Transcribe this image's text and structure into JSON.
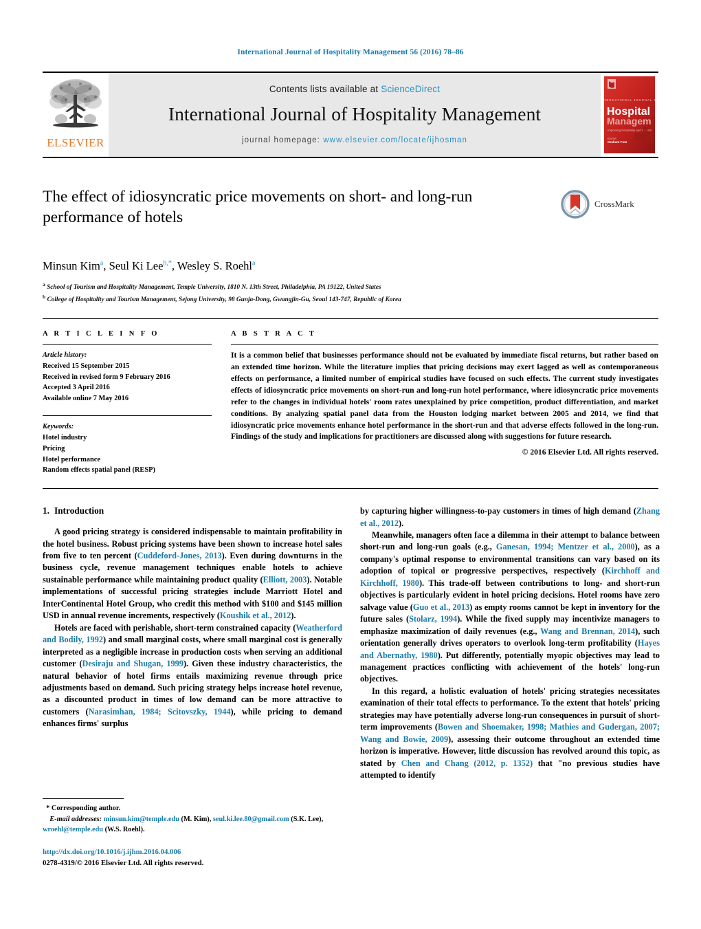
{
  "running_head": "International Journal of Hospitality Management 56 (2016) 78–86",
  "masthead": {
    "publisher_name": "ELSEVIER",
    "contents_prefix": "Contents lists available at ",
    "contents_link": "ScienceDirect",
    "journal_title": "International Journal of Hospitality Management",
    "homepage_prefix": "journal homepage: ",
    "homepage_url": "www.elsevier.com/locate/ijhosman",
    "cover_lines": {
      "kicker": "INTERNATIONAL JOURNAL OF",
      "line1": "Hospitality",
      "line2": "Management",
      "tagline": "Improving hospitality and tourism",
      "editor_label": "EDITOR",
      "editor_name": "Graham Fom"
    },
    "colors": {
      "banner_bg": "#e8e8e8",
      "link": "#2a8fc0",
      "elsevier_orange": "#e87722",
      "cover_red": "#c5211f"
    }
  },
  "article": {
    "title": "The effect of idiosyncratic price movements on short- and long-run performance of hotels",
    "crossmark_label": "CrossMark",
    "authors": [
      {
        "name": "Minsun Kim",
        "sup": "a"
      },
      {
        "name": "Seul Ki Lee",
        "sup": "b,*"
      },
      {
        "name": "Wesley S. Roehl",
        "sup": "a"
      }
    ],
    "affiliations": [
      {
        "sup": "a",
        "text": "School of Tourism and Hospitality Management, Temple University, 1810 N. 13th Street, Philadelphia, PA 19122, United States"
      },
      {
        "sup": "b",
        "text": "College of Hospitality and Tourism Management, Sejong University, 98 Gunja-Dong, Gwangjin-Gu, Seoul 143-747, Republic of Korea"
      }
    ]
  },
  "article_info": {
    "heading": "A R T I C L E   I N F O",
    "history_label": "Article history:",
    "history": [
      "Received 15 September 2015",
      "Received in revised form 9 February 2016",
      "Accepted 3 April 2016",
      "Available online 7 May 2016"
    ],
    "keywords_label": "Keywords:",
    "keywords": [
      "Hotel industry",
      "Pricing",
      "Hotel performance",
      "Random effects spatial panel (RESP)"
    ]
  },
  "abstract": {
    "heading": "A B S T R A C T",
    "text": "It is a common belief that businesses performance should not be evaluated by immediate fiscal returns, but rather based on an extended time horizon. While the literature implies that pricing decisions may exert lagged as well as contemporaneous effects on performance, a limited number of empirical studies have focused on such effects. The current study investigates effects of idiosyncratic price movements on short-run and long-run hotel performance, where idiosyncratic price movements refer to the changes in individual hotels' room rates unexplained by price competition, product differentiation, and market conditions. By analyzing spatial panel data from the Houston lodging market between 2005 and 2014, we find that idiosyncratic price movements enhance hotel performance in the short-run and that adverse effects followed in the long-run. Findings of the study and implications for practitioners are discussed along with suggestions for future research.",
    "copyright": "© 2016 Elsevier Ltd. All rights reserved."
  },
  "body": {
    "section_number": "1.",
    "section_title": "Introduction",
    "left_column": {
      "p1_a": "A good pricing strategy is considered indispensable to maintain profitability in the hotel business. Robust pricing systems have been shown to increase hotel sales from five to ten percent (",
      "p1_c1": "Cuddeford-Jones, 2013",
      "p1_b": "). Even during downturns in the business cycle, revenue management techniques enable hotels to achieve sustainable performance while maintaining product quality (",
      "p1_c2": "Elliott, 2003",
      "p1_d": "). Notable implementations of successful pricing strategies include Marriott Hotel and InterContinental Hotel Group, who credit this method with $100 and $145 million USD in annual revenue increments, respectively (",
      "p1_c3": "Koushik et al., 2012",
      "p1_e": ").",
      "p2_a": "Hotels are faced with perishable, short-term constrained capacity (",
      "p2_c1": "Weatherford and Bodily, 1992",
      "p2_b": ") and small marginal costs, where small marginal cost is generally interpreted as a negligible increase in production costs when serving an additional customer (",
      "p2_c2": "Desiraju and Shugan, 1999",
      "p2_c": "). Given these industry characteristics, the natural behavior of hotel firms entails maximizing revenue through price adjustments based on demand. Such pricing strategy helps increase hotel revenue, as a discounted product in times of low demand can be more attractive to customers (",
      "p2_c3": "Narasimhan, 1984; Scitovszky, 1944",
      "p2_d": "), while pricing to demand enhances firms' surplus"
    },
    "right_column": {
      "p1_a": "by capturing higher willingness-to-pay customers in times of high demand (",
      "p1_c1": "Zhang et al., 2012",
      "p1_b": ").",
      "p2_a": "Meanwhile, managers often face a dilemma in their attempt to balance between short-run and long-run goals (e.g., ",
      "p2_c1": "Ganesan, 1994; Mentzer et al., 2000",
      "p2_b": "), as a company's optimal response to environmental transitions can vary based on its adoption of topical or progressive perspectives, respectively (",
      "p2_c2": "Kirchhoff and Kirchhoff, 1980",
      "p2_c": "). This trade-off between contributions to long- and short-run objectives is particularly evident in hotel pricing decisions. Hotel rooms have zero salvage value (",
      "p2_c3": "Guo et al., 2013",
      "p2_d": ") as empty rooms cannot be kept in inventory for the future sales (",
      "p2_c4": "Stolarz, 1994",
      "p2_e": "). While the fixed supply may incentivize managers to emphasize maximization of daily revenues (e.g., ",
      "p2_c5": "Wang and Brennan, 2014",
      "p2_f": "), such orientation generally drives operators to overlook long-term profitability (",
      "p2_c6": "Hayes and Abernathy, 1980",
      "p2_g": "). Put differently, potentially myopic objectives may lead to management practices conflicting with achievement of the hotels' long-run objectives.",
      "p3_a": "In this regard, a holistic evaluation of hotels' pricing strategies necessitates examination of their total effects to performance. To the extent that hotels' pricing strategies may have potentially adverse long-run consequences in pursuit of short-term improvements (",
      "p3_c1": "Bowen and Shoemaker, 1998; Mathies and Gudergan, 2007; Wang and Bowie, 2009",
      "p3_b": "), assessing their outcome throughout an extended time horizon is imperative. However, little discussion has revolved around this topic, as stated by ",
      "p3_c2": "Chen and Chang (2012, p. 1352)",
      "p3_c": " that \"no previous studies have attempted to identify"
    }
  },
  "footnote": {
    "corresponding_marker": "*",
    "corresponding_text": "Corresponding author.",
    "email_label": "E-mail addresses:",
    "emails": [
      {
        "address": "minsun.kim@temple.edu",
        "owner": "(M. Kim)"
      },
      {
        "address": "seul.ki.lee.80@gmail.com",
        "owner": "(S.K. Lee)"
      },
      {
        "address": "wroehl@temple.edu",
        "owner": "(W.S. Roehl)"
      }
    ],
    "doi": "http://dx.doi.org/10.1016/j.ijhm.2016.04.006",
    "issn_line": "0278-4319/© 2016 Elsevier Ltd. All rights reserved."
  }
}
